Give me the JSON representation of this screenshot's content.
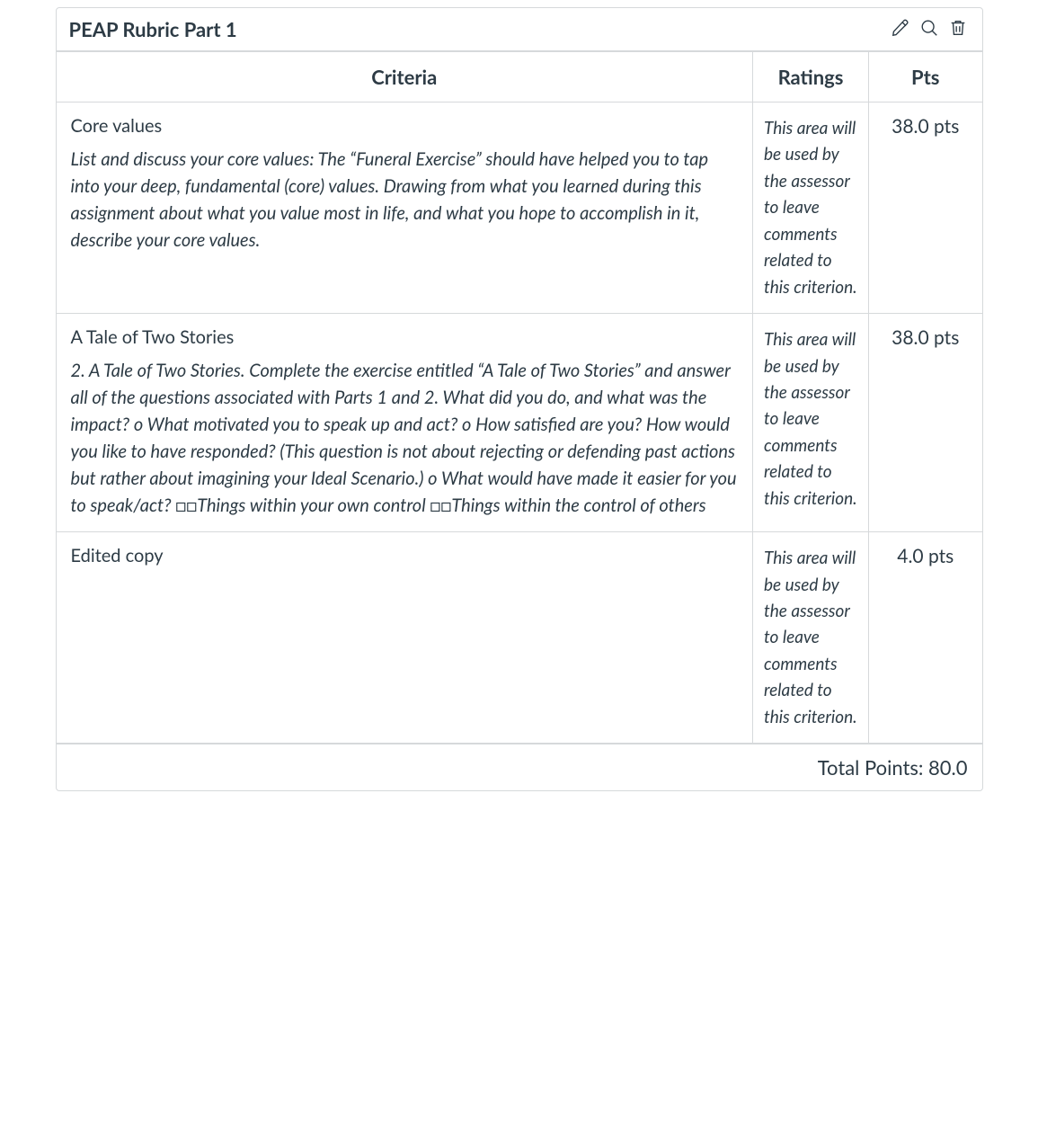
{
  "rubric": {
    "title": "PEAP Rubric Part 1",
    "columns": {
      "criteria": "Criteria",
      "ratings": "Ratings",
      "pts": "Pts"
    },
    "rows": [
      {
        "title": "Core values",
        "description": "List and discuss your core values: The “Funeral Exercise” should have helped you to tap into your deep, fundamental (core) values. Drawing from what you learned during this assignment about what you value most in life, and what you hope to accomplish in it, describe your core values.",
        "ratings": "This area will be used by the assessor to leave comments related to this criterion.",
        "pts": "38.0 pts"
      },
      {
        "title": "A Tale of Two Stories",
        "description": "2. A Tale of Two Stories. Complete the exercise entitled “A Tale of Two Stories” and answer all of the questions associated with Parts 1 and 2. What did you do, and what was the impact? o What motivated you to speak up and act? o How satisfied are you? How would you like to have responded? (This question is not about rejecting or defending past actions but rather about imagining your Ideal Scenario.) o What would have made it easier for you to speak/act? □□Things within your own control □□Things within the control of others",
        "ratings": "This area will be used by the assessor to leave comments related to this criterion.",
        "pts": "38.0 pts"
      },
      {
        "title": "Edited copy",
        "description": "",
        "ratings": "This area will be used by the assessor to leave comments related to this criterion.",
        "pts": "4.0 pts"
      }
    ],
    "total_label": "Total Points: 80.0"
  },
  "icons": {
    "edit": "edit-icon",
    "search": "search-icon",
    "delete": "trash-icon"
  }
}
